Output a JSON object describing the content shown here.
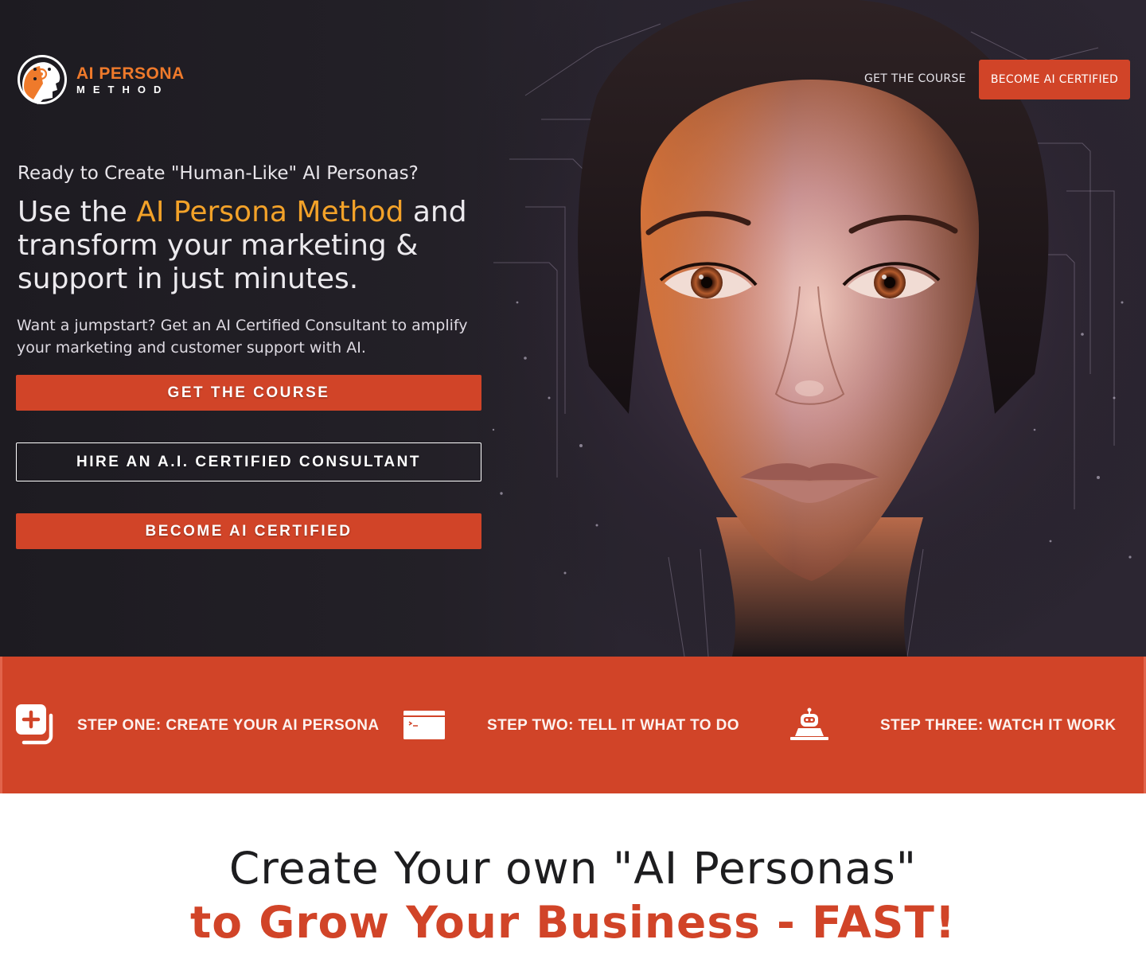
{
  "brand": {
    "line1": "AI PERSONA",
    "line2": "METHOD"
  },
  "nav": {
    "link": "GET THE COURSE",
    "cta": "BECOME AI CERTIFIED"
  },
  "hero": {
    "kicker": "Ready to Create \"Human-Like\" AI Personas?",
    "headline_pre": "Use the ",
    "headline_accent": "AI Persona Method",
    "headline_post": " and transform your marketing & support in just minutes.",
    "sub": "Want a jumpstart? Get an AI Certified Consultant to amplify your marketing and customer support with AI.",
    "buttons": [
      "GET THE COURSE",
      "HIRE AN A.I. CERTIFIED CONSULTANT",
      "BECOME AI CERTIFIED"
    ]
  },
  "steps": [
    {
      "icon": "add-layers-icon",
      "label": "STEP ONE: CREATE YOUR AI PERSONA"
    },
    {
      "icon": "terminal-window-icon",
      "label": "STEP TWO: TELL IT WHAT TO DO"
    },
    {
      "icon": "robot-laptop-icon",
      "label": "STEP THREE: WATCH IT WORK"
    }
  ],
  "section": {
    "title_line1": "Create Your own \"AI Personas\"",
    "title_line2": "to Grow Your Business - FAST!"
  },
  "colors": {
    "accent": "#d14428",
    "orange": "#f3a229",
    "hero_bg": "#1f1c22"
  }
}
